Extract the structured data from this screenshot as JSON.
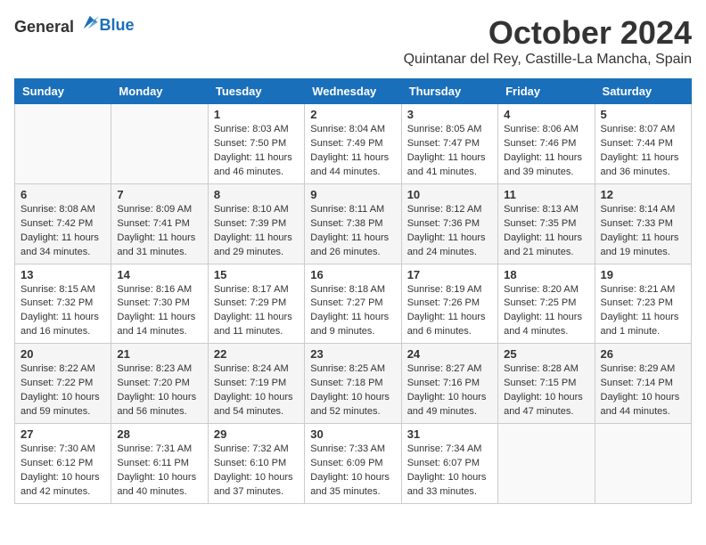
{
  "header": {
    "logo_general": "General",
    "logo_blue": "Blue",
    "month_title": "October 2024",
    "location": "Quintanar del Rey, Castille-La Mancha, Spain"
  },
  "weekdays": [
    "Sunday",
    "Monday",
    "Tuesday",
    "Wednesday",
    "Thursday",
    "Friday",
    "Saturday"
  ],
  "weeks": [
    [
      {
        "day": "",
        "sunrise": "",
        "sunset": "",
        "daylight": ""
      },
      {
        "day": "",
        "sunrise": "",
        "sunset": "",
        "daylight": ""
      },
      {
        "day": "1",
        "sunrise": "Sunrise: 8:03 AM",
        "sunset": "Sunset: 7:50 PM",
        "daylight": "Daylight: 11 hours and 46 minutes."
      },
      {
        "day": "2",
        "sunrise": "Sunrise: 8:04 AM",
        "sunset": "Sunset: 7:49 PM",
        "daylight": "Daylight: 11 hours and 44 minutes."
      },
      {
        "day": "3",
        "sunrise": "Sunrise: 8:05 AM",
        "sunset": "Sunset: 7:47 PM",
        "daylight": "Daylight: 11 hours and 41 minutes."
      },
      {
        "day": "4",
        "sunrise": "Sunrise: 8:06 AM",
        "sunset": "Sunset: 7:46 PM",
        "daylight": "Daylight: 11 hours and 39 minutes."
      },
      {
        "day": "5",
        "sunrise": "Sunrise: 8:07 AM",
        "sunset": "Sunset: 7:44 PM",
        "daylight": "Daylight: 11 hours and 36 minutes."
      }
    ],
    [
      {
        "day": "6",
        "sunrise": "Sunrise: 8:08 AM",
        "sunset": "Sunset: 7:42 PM",
        "daylight": "Daylight: 11 hours and 34 minutes."
      },
      {
        "day": "7",
        "sunrise": "Sunrise: 8:09 AM",
        "sunset": "Sunset: 7:41 PM",
        "daylight": "Daylight: 11 hours and 31 minutes."
      },
      {
        "day": "8",
        "sunrise": "Sunrise: 8:10 AM",
        "sunset": "Sunset: 7:39 PM",
        "daylight": "Daylight: 11 hours and 29 minutes."
      },
      {
        "day": "9",
        "sunrise": "Sunrise: 8:11 AM",
        "sunset": "Sunset: 7:38 PM",
        "daylight": "Daylight: 11 hours and 26 minutes."
      },
      {
        "day": "10",
        "sunrise": "Sunrise: 8:12 AM",
        "sunset": "Sunset: 7:36 PM",
        "daylight": "Daylight: 11 hours and 24 minutes."
      },
      {
        "day": "11",
        "sunrise": "Sunrise: 8:13 AM",
        "sunset": "Sunset: 7:35 PM",
        "daylight": "Daylight: 11 hours and 21 minutes."
      },
      {
        "day": "12",
        "sunrise": "Sunrise: 8:14 AM",
        "sunset": "Sunset: 7:33 PM",
        "daylight": "Daylight: 11 hours and 19 minutes."
      }
    ],
    [
      {
        "day": "13",
        "sunrise": "Sunrise: 8:15 AM",
        "sunset": "Sunset: 7:32 PM",
        "daylight": "Daylight: 11 hours and 16 minutes."
      },
      {
        "day": "14",
        "sunrise": "Sunrise: 8:16 AM",
        "sunset": "Sunset: 7:30 PM",
        "daylight": "Daylight: 11 hours and 14 minutes."
      },
      {
        "day": "15",
        "sunrise": "Sunrise: 8:17 AM",
        "sunset": "Sunset: 7:29 PM",
        "daylight": "Daylight: 11 hours and 11 minutes."
      },
      {
        "day": "16",
        "sunrise": "Sunrise: 8:18 AM",
        "sunset": "Sunset: 7:27 PM",
        "daylight": "Daylight: 11 hours and 9 minutes."
      },
      {
        "day": "17",
        "sunrise": "Sunrise: 8:19 AM",
        "sunset": "Sunset: 7:26 PM",
        "daylight": "Daylight: 11 hours and 6 minutes."
      },
      {
        "day": "18",
        "sunrise": "Sunrise: 8:20 AM",
        "sunset": "Sunset: 7:25 PM",
        "daylight": "Daylight: 11 hours and 4 minutes."
      },
      {
        "day": "19",
        "sunrise": "Sunrise: 8:21 AM",
        "sunset": "Sunset: 7:23 PM",
        "daylight": "Daylight: 11 hours and 1 minute."
      }
    ],
    [
      {
        "day": "20",
        "sunrise": "Sunrise: 8:22 AM",
        "sunset": "Sunset: 7:22 PM",
        "daylight": "Daylight: 10 hours and 59 minutes."
      },
      {
        "day": "21",
        "sunrise": "Sunrise: 8:23 AM",
        "sunset": "Sunset: 7:20 PM",
        "daylight": "Daylight: 10 hours and 56 minutes."
      },
      {
        "day": "22",
        "sunrise": "Sunrise: 8:24 AM",
        "sunset": "Sunset: 7:19 PM",
        "daylight": "Daylight: 10 hours and 54 minutes."
      },
      {
        "day": "23",
        "sunrise": "Sunrise: 8:25 AM",
        "sunset": "Sunset: 7:18 PM",
        "daylight": "Daylight: 10 hours and 52 minutes."
      },
      {
        "day": "24",
        "sunrise": "Sunrise: 8:27 AM",
        "sunset": "Sunset: 7:16 PM",
        "daylight": "Daylight: 10 hours and 49 minutes."
      },
      {
        "day": "25",
        "sunrise": "Sunrise: 8:28 AM",
        "sunset": "Sunset: 7:15 PM",
        "daylight": "Daylight: 10 hours and 47 minutes."
      },
      {
        "day": "26",
        "sunrise": "Sunrise: 8:29 AM",
        "sunset": "Sunset: 7:14 PM",
        "daylight": "Daylight: 10 hours and 44 minutes."
      }
    ],
    [
      {
        "day": "27",
        "sunrise": "Sunrise: 7:30 AM",
        "sunset": "Sunset: 6:12 PM",
        "daylight": "Daylight: 10 hours and 42 minutes."
      },
      {
        "day": "28",
        "sunrise": "Sunrise: 7:31 AM",
        "sunset": "Sunset: 6:11 PM",
        "daylight": "Daylight: 10 hours and 40 minutes."
      },
      {
        "day": "29",
        "sunrise": "Sunrise: 7:32 AM",
        "sunset": "Sunset: 6:10 PM",
        "daylight": "Daylight: 10 hours and 37 minutes."
      },
      {
        "day": "30",
        "sunrise": "Sunrise: 7:33 AM",
        "sunset": "Sunset: 6:09 PM",
        "daylight": "Daylight: 10 hours and 35 minutes."
      },
      {
        "day": "31",
        "sunrise": "Sunrise: 7:34 AM",
        "sunset": "Sunset: 6:07 PM",
        "daylight": "Daylight: 10 hours and 33 minutes."
      },
      {
        "day": "",
        "sunrise": "",
        "sunset": "",
        "daylight": ""
      },
      {
        "day": "",
        "sunrise": "",
        "sunset": "",
        "daylight": ""
      }
    ]
  ]
}
